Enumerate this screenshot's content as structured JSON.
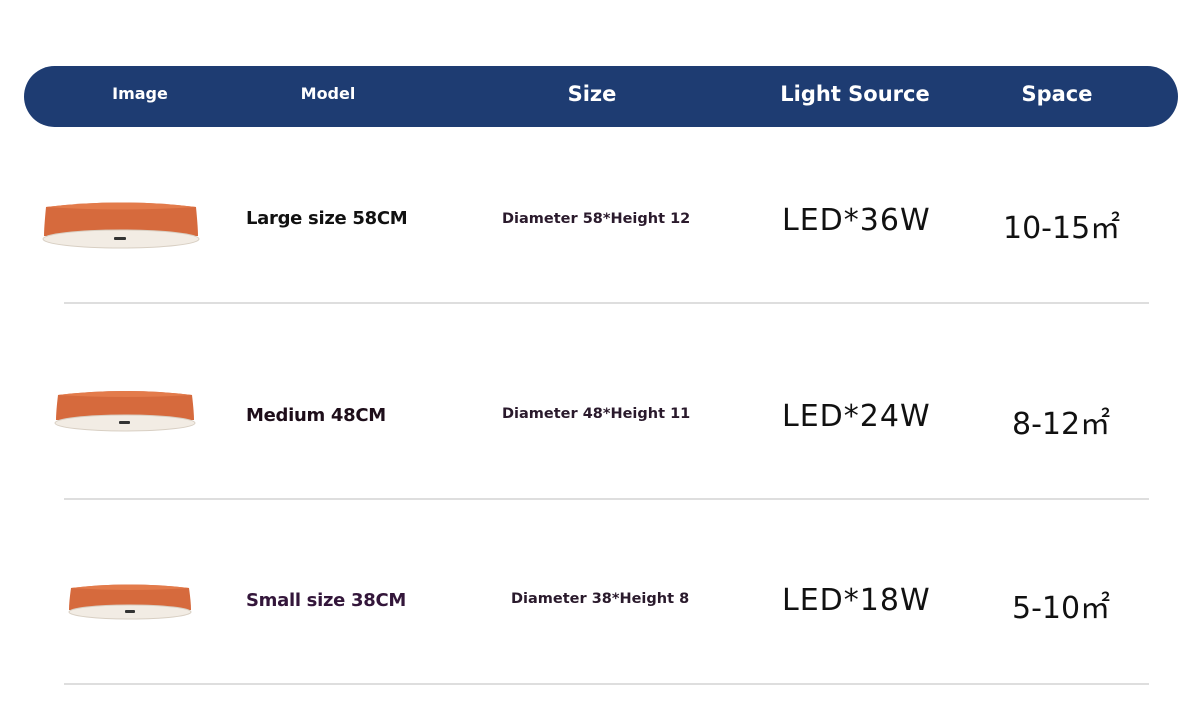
{
  "header": {
    "image": "Image",
    "model": "Model",
    "size": "Size",
    "light_source": "Light Source",
    "space": "Space"
  },
  "rows": [
    {
      "model": "Large size 58CM",
      "size": "Diameter 58*Height 12",
      "light_source": "LED*36W",
      "space": "10-15㎡"
    },
    {
      "model": "Medium 48CM",
      "size": "Diameter 48*Height 11",
      "light_source": "LED*24W",
      "space": "8-12㎡"
    },
    {
      "model": "Small size 38CM",
      "size": "Diameter 38*Height 8",
      "light_source": "LED*18W",
      "space": "5-10㎡"
    }
  ],
  "colors": {
    "header_bg": "#1e3c72",
    "lamp_shade": "#d86a3c",
    "divider": "#dedede"
  }
}
